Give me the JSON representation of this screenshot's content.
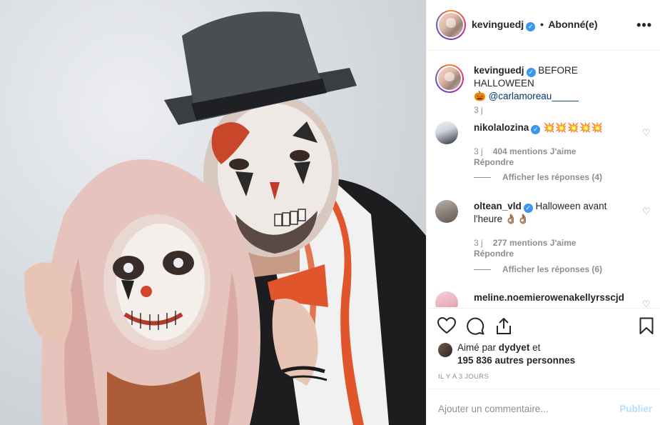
{
  "header": {
    "username": "kevinguedj",
    "verified_badge": "verified-check-icon",
    "separator": "•",
    "follow_status": "Abonné(e)",
    "more_icon": "more-options-icon"
  },
  "caption": {
    "username": "kevinguedj",
    "text": "BEFORE HALLOWEEN",
    "emoji": "🎃",
    "mention": "@carlamoreau_____",
    "time": "3 j"
  },
  "comments": [
    {
      "username": "nikolalozina",
      "text": "💥💥💥💥💥",
      "time": "3 j",
      "likes": "404 mentions J'aime",
      "reply": "Répondre",
      "view_replies": "Afficher les réponses (4)"
    },
    {
      "username": "oltean_vld",
      "text": "Halloween avant l'heure 👌🏽👌🏽",
      "time": "3 j",
      "likes": "277 mentions J'aime",
      "reply": "Répondre",
      "view_replies": "Afficher les réponses (6)"
    },
    {
      "username": "meline.noemierowenakellyrsscjd",
      "text": ""
    }
  ],
  "actions": {
    "like_icon": "heart-icon",
    "comment_icon": "comment-icon",
    "share_icon": "share-icon",
    "save_icon": "bookmark-icon"
  },
  "likes": {
    "prefix": "Aimé par",
    "user": "dydyet",
    "conjunction": "et",
    "others": "195 836 autres personnes"
  },
  "timestamp": "IL Y A 3 JOURS",
  "add_comment": {
    "placeholder": "Ajouter un commentaire...",
    "publish_label": "Publier"
  },
  "colors": {
    "accent_blue": "#3897f0",
    "publish_disabled": "#b2dffc",
    "muted_text": "#8e8e8e",
    "text": "#262626"
  }
}
